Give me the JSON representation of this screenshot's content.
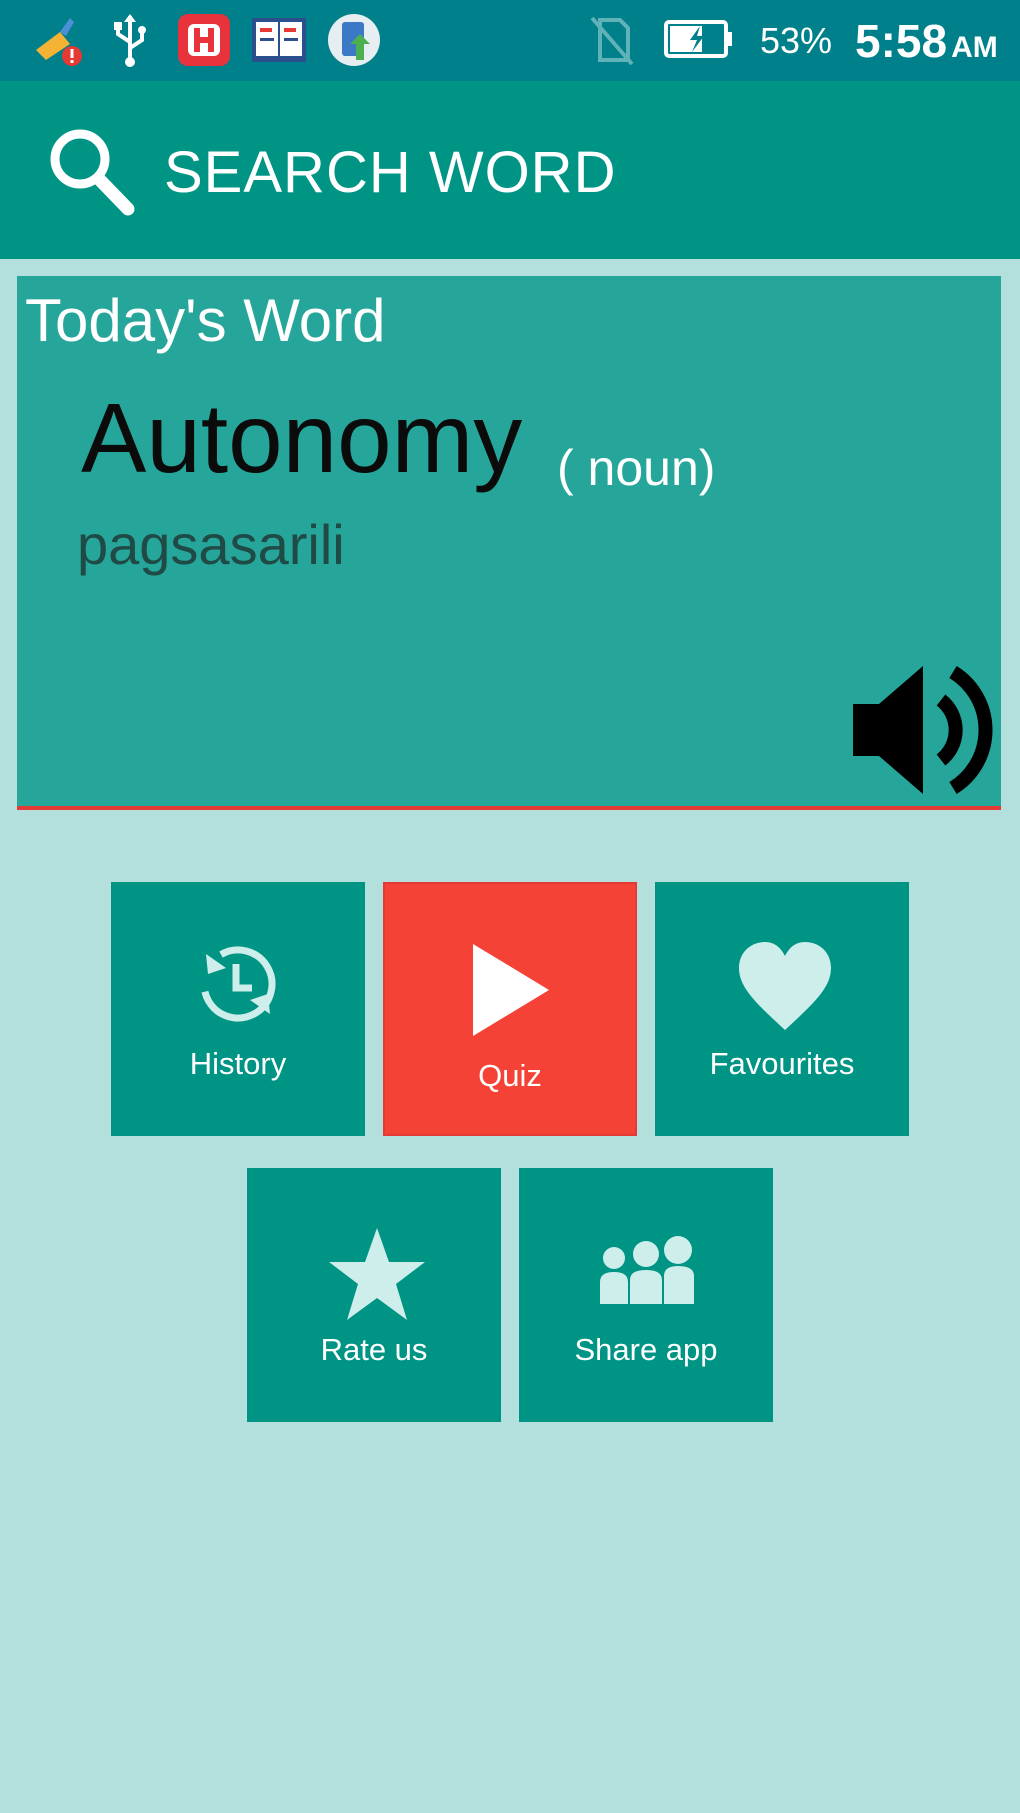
{
  "status_bar": {
    "battery_percent": "53%",
    "time": "5:58",
    "ampm": "AM"
  },
  "toolbar": {
    "title": "SEARCH WORD"
  },
  "word_card": {
    "heading": "Today's Word",
    "word": "Autonomy",
    "part_of_speech": "( noun)",
    "translation": "pagsasarili"
  },
  "menu": {
    "history": "History",
    "quiz": "Quiz",
    "favourites": "Favourites",
    "rate": "Rate us",
    "share": "Share app"
  },
  "colors": {
    "status_bar": "#00808a",
    "toolbar": "#009485",
    "background": "#b3dfdc",
    "card": "#26a69a",
    "accent": "#f44336",
    "icon_light": "#cdeeea"
  }
}
